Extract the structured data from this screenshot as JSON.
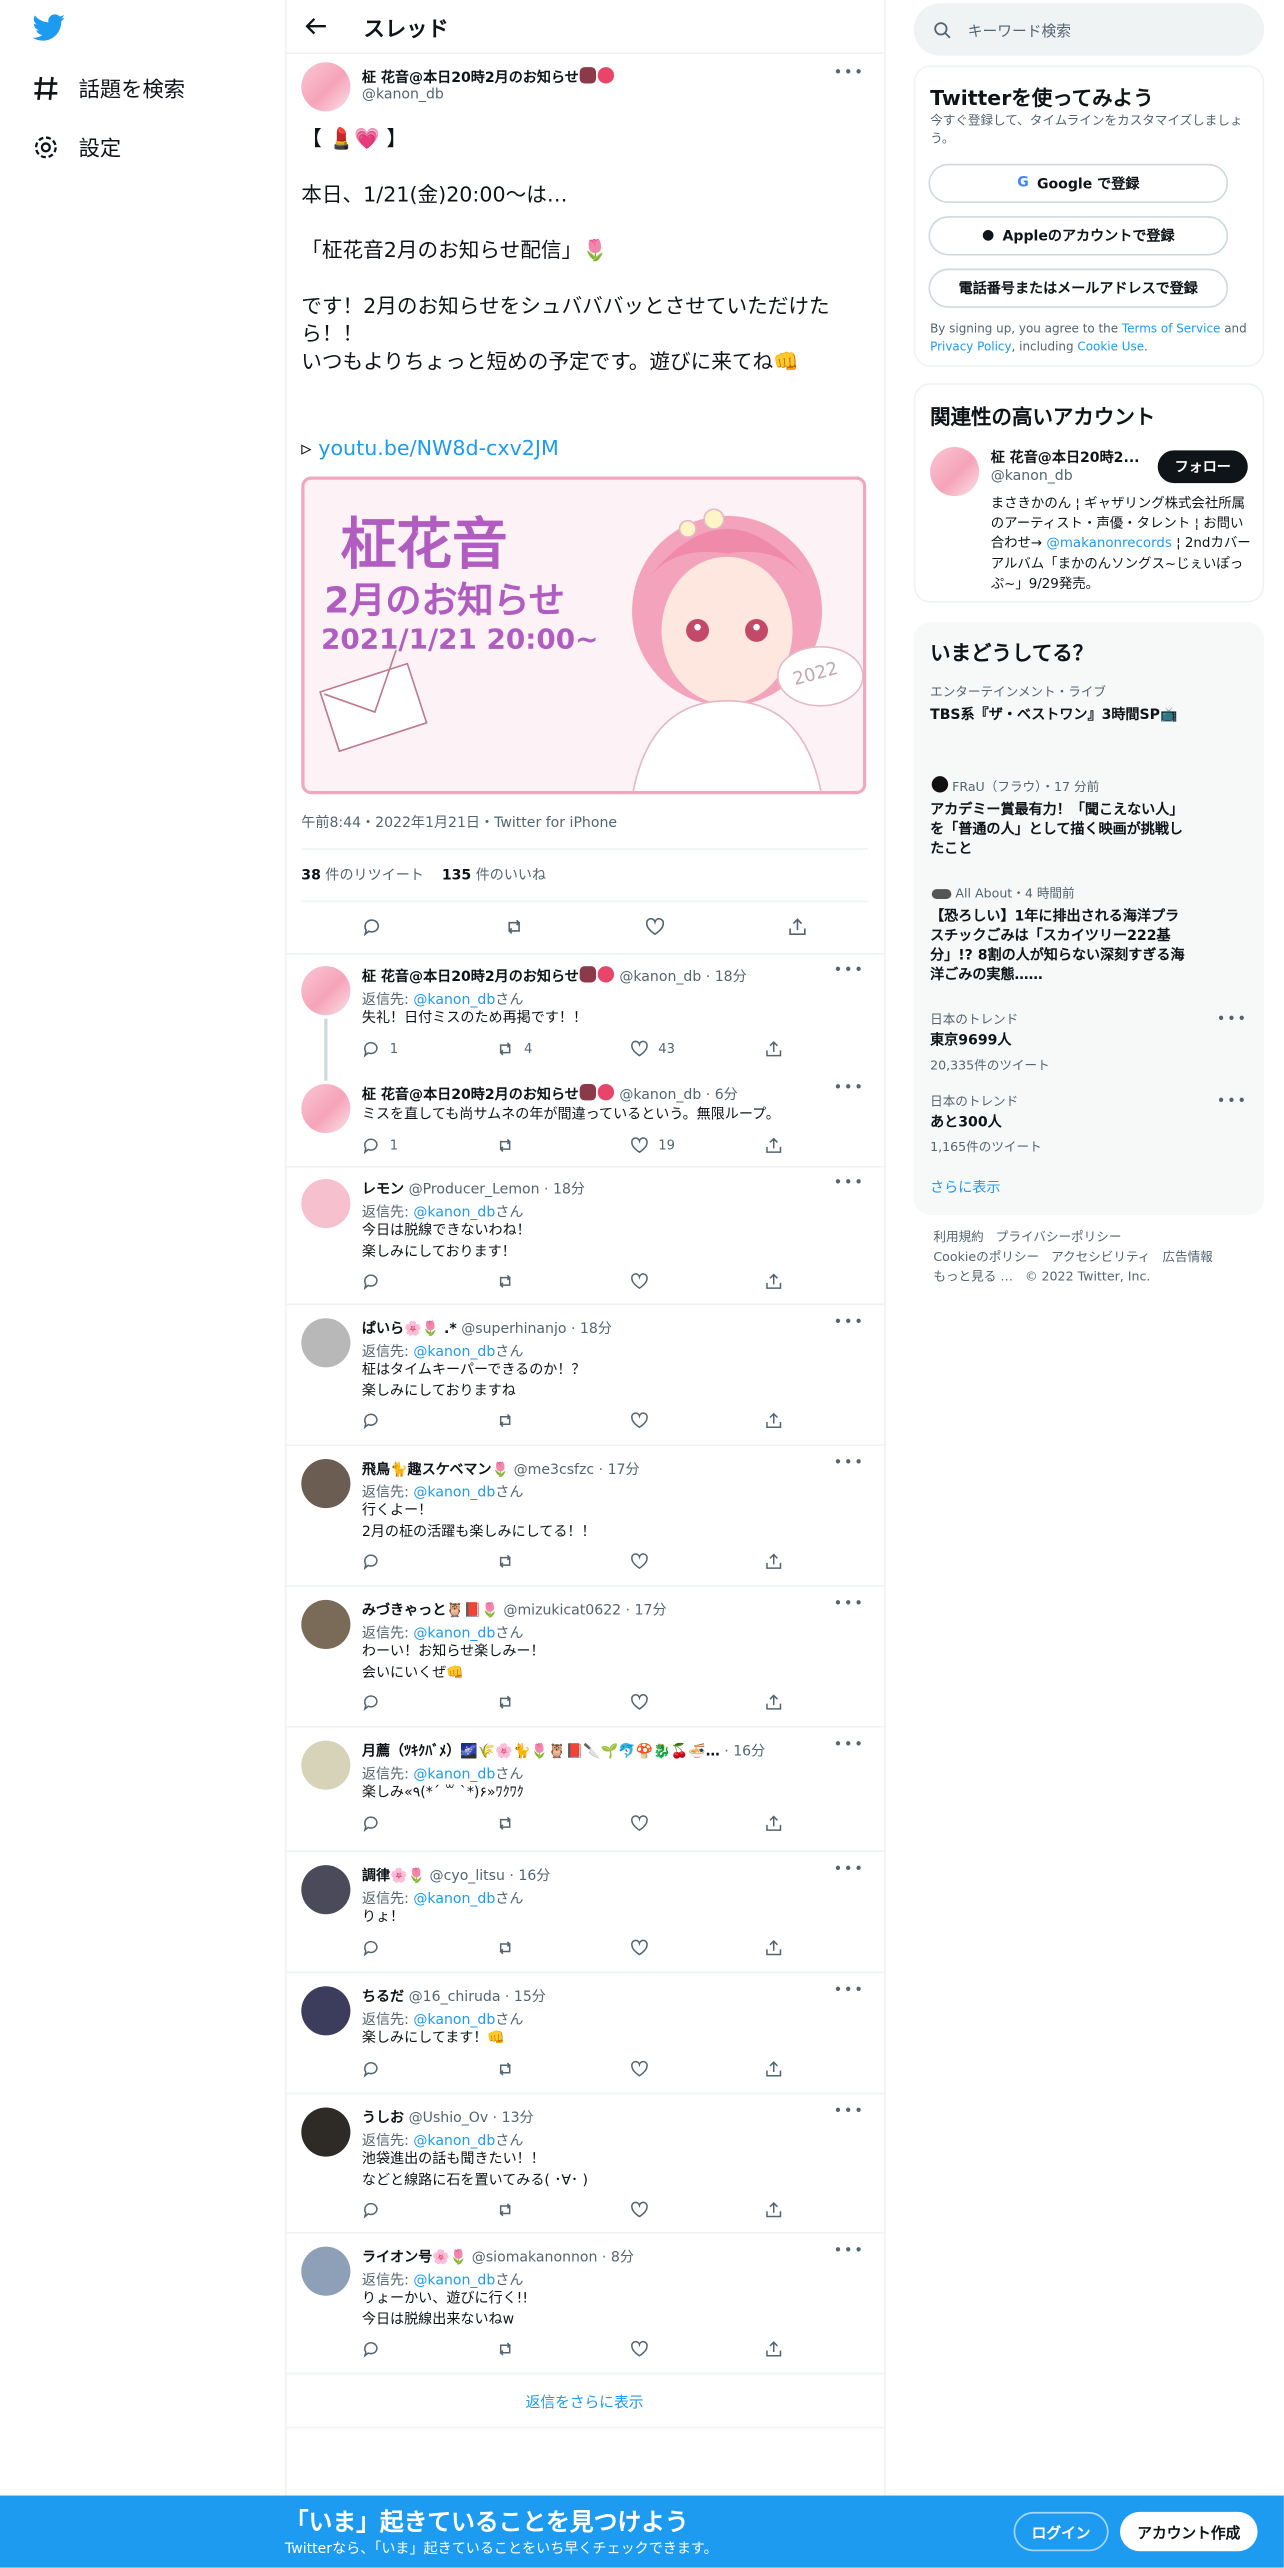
{
  "nav": {
    "explore_label": "話題を検索",
    "settings_label": "設定"
  },
  "header": {
    "title": "スレッド"
  },
  "tweet": {
    "name": "柾 花音@本日20時2月のお知らせ",
    "handle": "@kanon_db",
    "text": "【 💄💗 】\n\n本日、1/21(金)20:00～は…\n\n「柾花音2月のお知らせ配信」🌷\n\nです！2月のお知らせをシュバババッとさせていただけたら！！\nいつもよりちょっと短めの予定です。遊びに来てね👊",
    "link_prefix": "▹",
    "link": "youtu.be/NW8d-cxv2JM",
    "media": {
      "title1": "柾花音",
      "title2": "2月のお知らせ",
      "date": "2021/1/21 20:00~",
      "badge": "2022"
    },
    "meta": "午前8:44・2022年1月21日・Twitter for iPhone",
    "retweets": "38",
    "retweets_label": "件のリツイート",
    "likes": "135",
    "likes_label": "件のいいね"
  },
  "replies": [
    {
      "name": "柾 花音@本日20時2月のお知らせ",
      "handle": "@kanon_db",
      "time": "18分",
      "reply_to": "@kanon_db",
      "body": "失礼！日付ミスのため再掲です！！",
      "counts": [
        "1",
        "4",
        "43",
        ""
      ]
    },
    {
      "name": "柾 花音@本日20時2月のお知らせ",
      "handle": "@kanon_db",
      "time": "6分",
      "reply_to": "",
      "body": "ミスを直しても尚サムネの年が間違っているという。無限ループ。",
      "counts": [
        "1",
        "",
        "19",
        ""
      ]
    },
    {
      "name": "レモン",
      "handle": "@Producer_Lemon",
      "time": "18分",
      "reply_to": "@kanon_db",
      "body": "今日は脱線できないわね！\n楽しみにしております！",
      "counts": [
        "",
        "",
        "",
        ""
      ]
    },
    {
      "name": "ぱいら🌸🌷 .*",
      "handle": "@superhinanjo",
      "time": "18分",
      "reply_to": "@kanon_db",
      "body": "柾はタイムキーパーできるのか！？\n楽しみにしておりますね",
      "counts": [
        "",
        "",
        "",
        ""
      ]
    },
    {
      "name": "飛鳥🐈趣スケベマン🌷",
      "handle": "@me3csfzc",
      "time": "17分",
      "reply_to": "@kanon_db",
      "body": "行くよー！\n2月の柾の活躍も楽しみにしてる！！",
      "counts": [
        "",
        "",
        "",
        ""
      ]
    },
    {
      "name": "みづきゃっと🦉📕🌷",
      "handle": "@mizukicat0622",
      "time": "17分",
      "reply_to": "@kanon_db",
      "body": "わーい！お知らせ楽しみー！\n会いにいくぜ👊",
      "counts": [
        "",
        "",
        "",
        ""
      ]
    },
    {
      "name": "月薦（ﾂｷｸﾊﾞﾒ）🌌🌾🌸🐈🌷🦉📕🔪🌱🐬🍄🐉🍒🍜…",
      "handle": "",
      "time": "16分",
      "reply_to": "@kanon_db",
      "body": "楽しみ«٩(*´ ꒳ `*)۶»ﾜｸﾜｸ",
      "counts": [
        "",
        "",
        "",
        ""
      ]
    },
    {
      "name": "調律🌸🌷",
      "handle": "@cyo_litsu",
      "time": "16分",
      "reply_to": "@kanon_db",
      "body": "りょ！",
      "counts": [
        "",
        "",
        "",
        ""
      ]
    },
    {
      "name": "ちるだ",
      "handle": "@16_chiruda",
      "time": "15分",
      "reply_to": "@kanon_db",
      "body": "楽しみにしてます！👊",
      "counts": [
        "",
        "",
        "",
        ""
      ]
    },
    {
      "name": "うしお",
      "handle": "@Ushio_Ov",
      "time": "13分",
      "reply_to": "@kanon_db",
      "body": "池袋進出の話も聞きたい！！\nなどと線路に石を置いてみる( ･∀･ )",
      "counts": [
        "",
        "",
        "",
        ""
      ]
    },
    {
      "name": "ライオン号🌸🌷",
      "handle": "@siomakanonnon",
      "time": "8分",
      "reply_to": "@kanon_db",
      "body": "りょーかい、遊びに行く!!\n今日は脱線出来ないねw",
      "counts": [
        "",
        "",
        "",
        ""
      ]
    }
  ],
  "reply_to_prefix": "返信先: ",
  "reply_to_suffix": "さん",
  "show_more_replies": "返信をさらに表示",
  "sidebar": {
    "search_placeholder": "キーワード検索",
    "signup": {
      "title": "Twitterを使ってみよう",
      "desc": "今すぐ登録して、タイムラインをカスタマイズしましょう。",
      "google": "Google で登録",
      "apple": "Appleのアカウントで登録",
      "phone": "電話番号またはメールアドレスで登録",
      "terms_1": "By signing up, you agree to the ",
      "terms_link": "Terms of Service",
      "terms_2": " and ",
      "privacy_link": "Privacy Policy",
      "terms_3": ", including ",
      "cookie_link": "Cookie Use",
      "terms_4": "."
    },
    "related": {
      "title": "関連性の高いアカウント",
      "name": "柾 花音@本日20時2...",
      "handle": "@kanon_db",
      "follow": "フォロー",
      "bio_1": "まさきかのん ¦ ギャザリング株式会社所属のアーティスト・声優・タレント ¦ お問い合わせ→ ",
      "bio_link": "@makanonrecords",
      "bio_2": " ¦ 2ndカバーアルバム「まかのんソングス~じぇいぽっぷ~」9/29発売。"
    },
    "trends": {
      "title": "いまどうしてる？",
      "items": [
        {
          "cat": "エンターテインメント・ライブ",
          "title": "TBS系『ザ・ベストワン』3時間SP📺",
          "count": ""
        },
        {
          "cat": "FRaU（フラウ）・17 分前",
          "title": "アカデミー賞最有力！「聞こえない人」を「普通の人」として描く映画が挑戦したこと",
          "count": ""
        },
        {
          "cat": "All About・4 時間前",
          "title": "【恐ろしい】1年に排出される海洋プラスチックごみは「スカイツリー222基分」!? 8割の人が知らない深刻すぎる海洋ごみの実態……",
          "count": ""
        },
        {
          "cat": "日本のトレンド",
          "title": "東京9699人",
          "count": "20,335件のツイート"
        },
        {
          "cat": "日本のトレンド",
          "title": "あと300人",
          "count": "1,165件のツイート"
        }
      ],
      "show_more": "さらに表示"
    },
    "footer": [
      "利用規約",
      "プライバシーポリシー",
      "Cookieのポリシー",
      "アクセシビリティ",
      "広告情報",
      "もっと見る …",
      "© 2022 Twitter, Inc."
    ]
  },
  "bottom": {
    "title": "「いま」起きていることを見つけよう",
    "sub": "Twitterなら、「いま」起きていることをいち早くチェックできます。",
    "login": "ログイン",
    "signup": "アカウント作成"
  },
  "colors": {
    "accent": "#1d9bf0",
    "media_border": "#f0a7c0",
    "media_purple": "#b05cc0"
  }
}
